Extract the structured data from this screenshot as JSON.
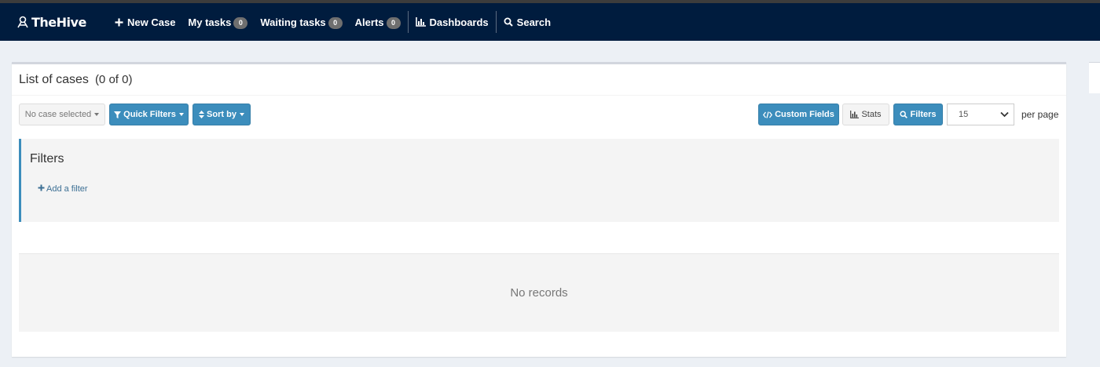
{
  "navbar": {
    "brand": "TheHive",
    "items": [
      {
        "label": "New Case",
        "icon": "plus-icon"
      },
      {
        "label": "My tasks",
        "badge": "0"
      },
      {
        "label": "Waiting tasks",
        "badge": "0"
      },
      {
        "label": "Alerts",
        "badge": "0"
      },
      {
        "label": "Dashboards",
        "icon": "bar-chart-icon"
      },
      {
        "label": "Search",
        "icon": "search-icon"
      }
    ]
  },
  "panel": {
    "title": "List of cases",
    "count": "(0 of 0)"
  },
  "toolbar": {
    "case_select": "No case selected",
    "quick_filters": "Quick Filters",
    "sort_by": "Sort by",
    "custom_fields": "Custom Fields",
    "stats": "Stats",
    "filters": "Filters",
    "page_size": "15",
    "per_page": "per page"
  },
  "filters": {
    "title": "Filters",
    "add_filter": "Add a filter"
  },
  "records": {
    "empty": "No records"
  },
  "colors": {
    "navbar_bg": "#001c3e",
    "primary": "#3c8dbc",
    "page_bg": "#ecf0f5"
  }
}
